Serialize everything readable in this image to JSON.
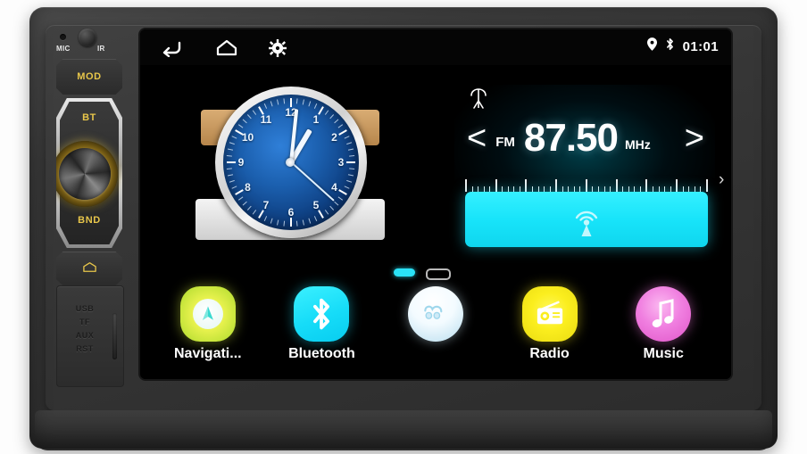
{
  "device": {
    "name": "car-stereo-head-unit",
    "labels": {
      "mic": "MIC",
      "ir": "IR"
    },
    "buttons": [
      {
        "id": "mod",
        "label": "MOD"
      },
      {
        "id": "bt",
        "label": "BT"
      },
      {
        "id": "bnd",
        "label": "BND"
      },
      {
        "id": "home",
        "label": "",
        "icon": "home-icon"
      }
    ],
    "knob": {
      "name": "volume-knob",
      "label": ""
    },
    "ports": {
      "lines": [
        "USB",
        "TF",
        "AUX",
        "RST"
      ]
    }
  },
  "statusbar": {
    "back_icon": "back-arrow-icon",
    "home_icon": "home-icon",
    "settings_icon": "gear-icon",
    "location_icon": "location-pin-icon",
    "bluetooth_icon": "bluetooth-icon",
    "time": "01:01"
  },
  "clock_widget": {
    "name": "analog-clock",
    "numerals": [
      "12",
      "1",
      "2",
      "3",
      "4",
      "5",
      "6",
      "7",
      "8",
      "9",
      "10",
      "11"
    ],
    "hour": 1,
    "minute": 1,
    "second": 22,
    "face_color": "#1b5fae"
  },
  "radio": {
    "band": "FM",
    "frequency": "87.50",
    "unit": "MHz",
    "prev_label": "<",
    "next_label": ">",
    "antenna_icon": "antenna-icon",
    "broadcast_icon": "broadcast-tower-icon",
    "bar_color": "#1ce0f6",
    "next_page_label": "›"
  },
  "pager": {
    "pages": 2,
    "active": 1
  },
  "dock": {
    "apps": [
      {
        "id": "navigation",
        "label": "Navigati...",
        "icon": "navigation-compass-icon",
        "color": "#dfee44"
      },
      {
        "id": "bluetooth",
        "label": "Bluetooth",
        "icon": "bluetooth-icon",
        "color": "#16dcf8"
      },
      {
        "id": "weather",
        "label": "",
        "icon": "cloud-icon",
        "color": "#eaf7ff"
      },
      {
        "id": "radio",
        "label": "Radio",
        "icon": "radio-receiver-icon",
        "color": "#fbee1e"
      },
      {
        "id": "music",
        "label": "Music",
        "icon": "music-note-icon",
        "color": "#f07fe0"
      }
    ]
  }
}
